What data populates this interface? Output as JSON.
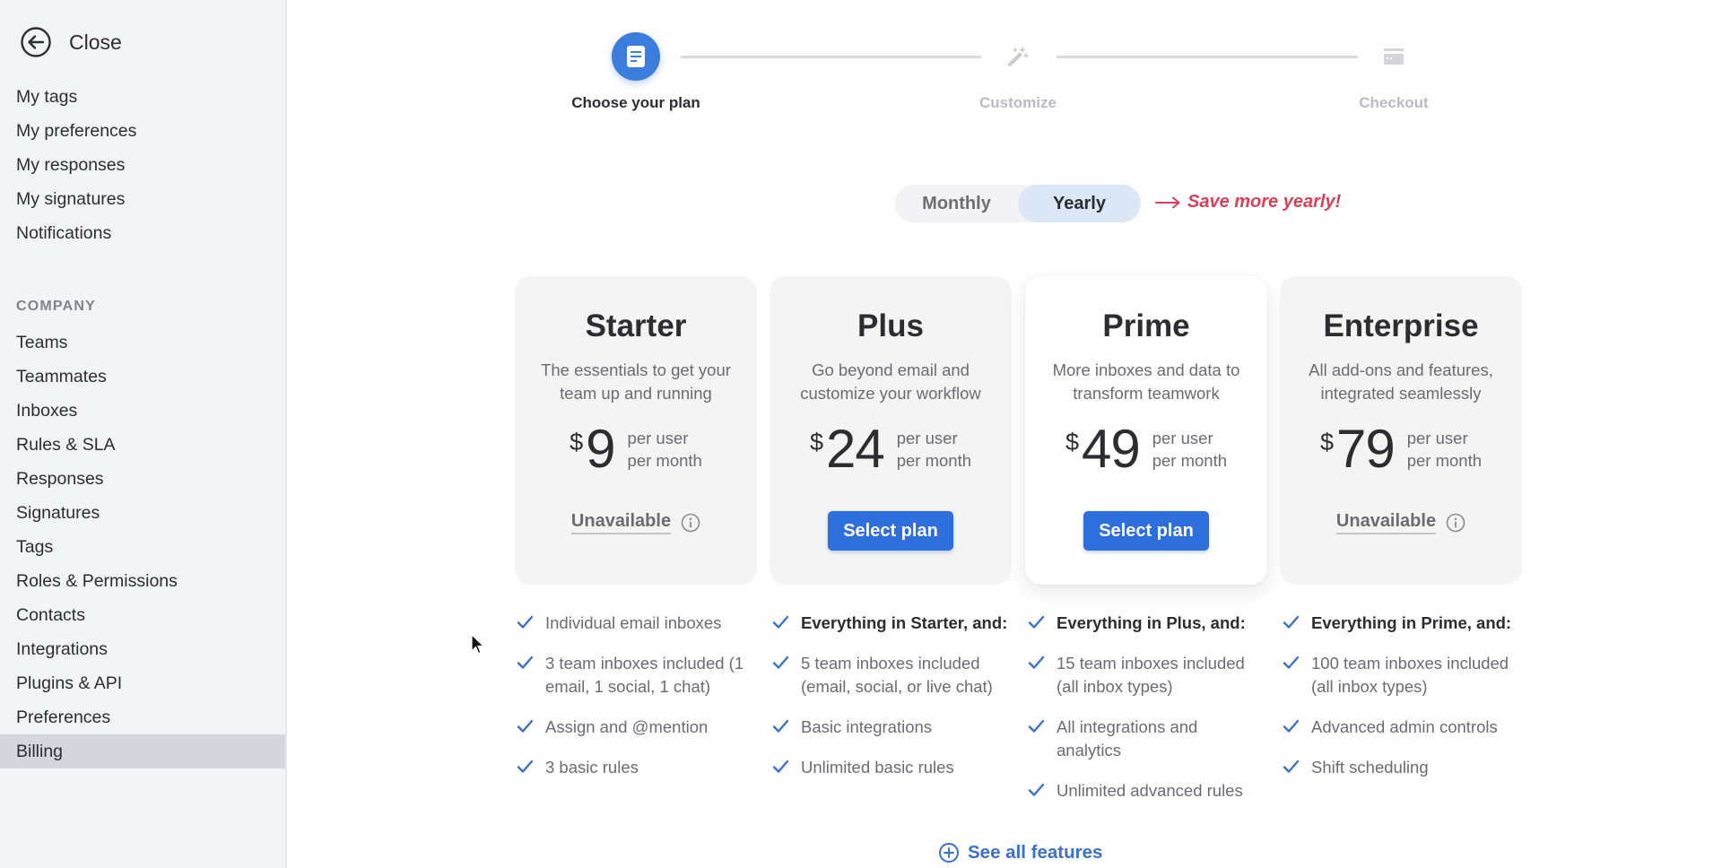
{
  "sidebar": {
    "close_label": "Close",
    "personal_items": [
      {
        "label": "My tags"
      },
      {
        "label": "My preferences"
      },
      {
        "label": "My responses"
      },
      {
        "label": "My signatures"
      },
      {
        "label": "Notifications"
      }
    ],
    "company_section_label": "COMPANY",
    "company_items": [
      {
        "label": "Teams"
      },
      {
        "label": "Teammates"
      },
      {
        "label": "Inboxes"
      },
      {
        "label": "Rules & SLA"
      },
      {
        "label": "Responses"
      },
      {
        "label": "Signatures"
      },
      {
        "label": "Tags"
      },
      {
        "label": "Roles & Permissions"
      },
      {
        "label": "Contacts"
      },
      {
        "label": "Integrations"
      },
      {
        "label": "Plugins & API"
      },
      {
        "label": "Preferences"
      },
      {
        "label": "Billing",
        "active": true
      }
    ]
  },
  "stepper": {
    "steps": [
      {
        "label": "Choose your plan",
        "icon": "document-icon",
        "state": "active"
      },
      {
        "label": "Customize",
        "icon": "magic-wand-icon",
        "state": "inactive"
      },
      {
        "label": "Checkout",
        "icon": "credit-card-icon",
        "state": "inactive"
      }
    ]
  },
  "billing_toggle": {
    "options": [
      "Monthly",
      "Yearly"
    ],
    "selected": "Yearly",
    "save_note": "Save more yearly!"
  },
  "colors": {
    "accent": "#2f6fdc",
    "save_note": "#d9405a",
    "check": "#3b72c8"
  },
  "plans": [
    {
      "name": "Starter",
      "description": "The essentials to get your team up and running",
      "currency": "$",
      "price": "9",
      "price_unit_line1": "per user",
      "price_unit_line2": "per month",
      "cta": {
        "type": "unavailable",
        "label": "Unavailable"
      },
      "featured": false,
      "features": [
        {
          "text": "Individual email inboxes",
          "bold": false
        },
        {
          "text": "3 team inboxes included (1 email, 1 social, 1 chat)",
          "bold": false
        },
        {
          "text": "Assign and @mention",
          "bold": false
        },
        {
          "text": "3 basic rules",
          "bold": false
        }
      ]
    },
    {
      "name": "Plus",
      "description": "Go beyond email and customize your workflow",
      "currency": "$",
      "price": "24",
      "price_unit_line1": "per user",
      "price_unit_line2": "per month",
      "cta": {
        "type": "select",
        "label": "Select plan"
      },
      "featured": false,
      "features": [
        {
          "text": "Everything in Starter, and:",
          "bold": true
        },
        {
          "text": "5 team inboxes included (email, social, or live chat)",
          "bold": false
        },
        {
          "text": "Basic integrations",
          "bold": false
        },
        {
          "text": "Unlimited basic rules",
          "bold": false
        }
      ]
    },
    {
      "name": "Prime",
      "description": "More inboxes and data to transform teamwork",
      "currency": "$",
      "price": "49",
      "price_unit_line1": "per user",
      "price_unit_line2": "per month",
      "cta": {
        "type": "select",
        "label": "Select plan"
      },
      "featured": true,
      "features": [
        {
          "text": "Everything in Plus, and:",
          "bold": true
        },
        {
          "text": "15 team inboxes included (all inbox types)",
          "bold": false
        },
        {
          "text": "All integrations and analytics",
          "bold": false
        },
        {
          "text": "Unlimited advanced rules",
          "bold": false
        }
      ]
    },
    {
      "name": "Enterprise",
      "description": "All add-ons and features, integrated seamlessly",
      "currency": "$",
      "price": "79",
      "price_unit_line1": "per user",
      "price_unit_line2": "per month",
      "cta": {
        "type": "unavailable",
        "label": "Unavailable"
      },
      "featured": false,
      "features": [
        {
          "text": "Everything in Prime, and:",
          "bold": true
        },
        {
          "text": "100 team inboxes included (all inbox types)",
          "bold": false
        },
        {
          "text": "Advanced admin controls",
          "bold": false
        },
        {
          "text": "Shift scheduling",
          "bold": false
        }
      ]
    }
  ],
  "see_all_features_label": "See all features"
}
